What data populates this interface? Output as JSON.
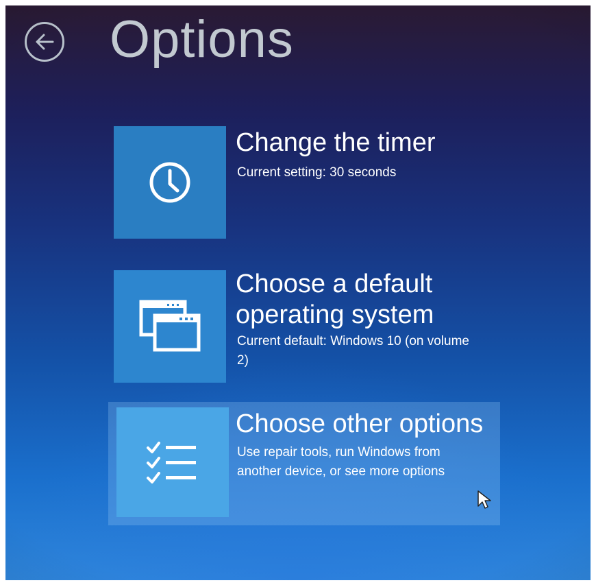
{
  "page": {
    "title": "Options",
    "back_icon": "back-arrow-icon"
  },
  "options": [
    {
      "title": "Change the timer",
      "subtitle": "Current setting: 30 seconds",
      "icon": "clock-icon"
    },
    {
      "title_line1": "Choose a default",
      "title_line2": "operating system",
      "subtitle": "Current default: Windows 10 (on volume 2)",
      "icon": "windows-stack-icon"
    },
    {
      "title": "Choose other options",
      "subtitle": "Use repair tools, run Windows from another device, or see more options",
      "icon": "checklist-icon",
      "highlighted": true
    }
  ],
  "colors": {
    "tile_blue": "#2a7ec2",
    "highlight": "#4aa6e6",
    "title_grey": "#c2c9d0"
  }
}
